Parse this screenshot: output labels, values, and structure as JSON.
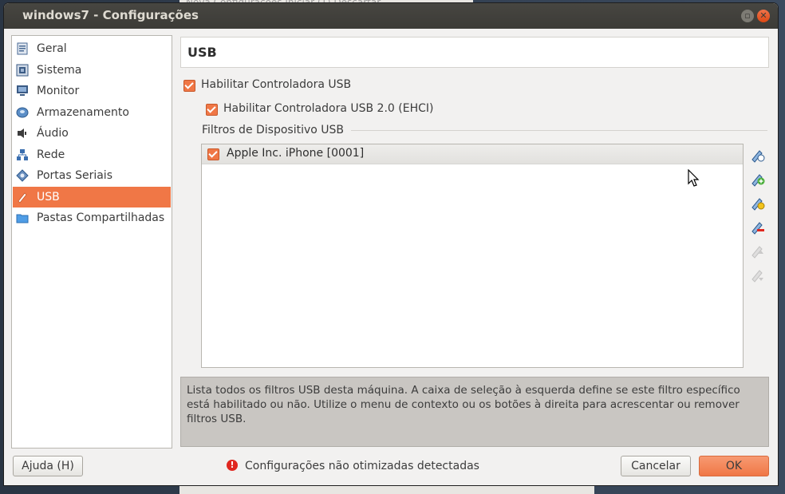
{
  "window": {
    "title": "windows7 - Configurações",
    "behind_title": "Nova   Configurações   Iniciar (T)   Descartar"
  },
  "sidebar": {
    "items": [
      {
        "label": "Geral",
        "icon": "general-icon"
      },
      {
        "label": "Sistema",
        "icon": "system-chip-icon"
      },
      {
        "label": "Monitor",
        "icon": "monitor-icon"
      },
      {
        "label": "Armazenamento",
        "icon": "storage-disk-icon"
      },
      {
        "label": "Áudio",
        "icon": "speaker-icon"
      },
      {
        "label": "Rede",
        "icon": "network-icon"
      },
      {
        "label": "Portas Seriais",
        "icon": "serial-port-icon"
      },
      {
        "label": "USB",
        "icon": "usb-icon",
        "active": true
      },
      {
        "label": "Pastas Compartilhadas",
        "icon": "shared-folder-icon"
      }
    ]
  },
  "page": {
    "title": "USB",
    "enable_usb_label": "Habilitar Controladora USB",
    "enable_usb_checked": true,
    "enable_usb2_label": "Habilitar Controladora USB 2.0  (EHCI)",
    "enable_usb2_checked": true,
    "filters_group_label": "Filtros de Dispositivo USB",
    "filters": [
      {
        "label": "Apple Inc. iPhone [0001]",
        "checked": true
      }
    ],
    "toolbar_icons": [
      "usb-filter-add-empty-icon",
      "usb-filter-add-device-icon",
      "usb-filter-edit-icon",
      "usb-filter-remove-icon",
      "usb-filter-move-up-icon",
      "usb-filter-move-down-icon"
    ],
    "info_text": "Lista todos os filtros USB desta máquina. A caixa de seleção à esquerda define se este filtro específico está habilitado ou não. Utilize o menu de contexto ou os botões à direita para acrescentar ou remover filtros USB."
  },
  "footer": {
    "help_label": "Ajuda (H)",
    "warning_text": "Configurações não otimizadas detectadas",
    "cancel_label": "Cancelar",
    "ok_label": "OK"
  },
  "colors": {
    "accent": "#f07746",
    "titlebar": "#3c3b37",
    "warning": "#e0271f"
  }
}
